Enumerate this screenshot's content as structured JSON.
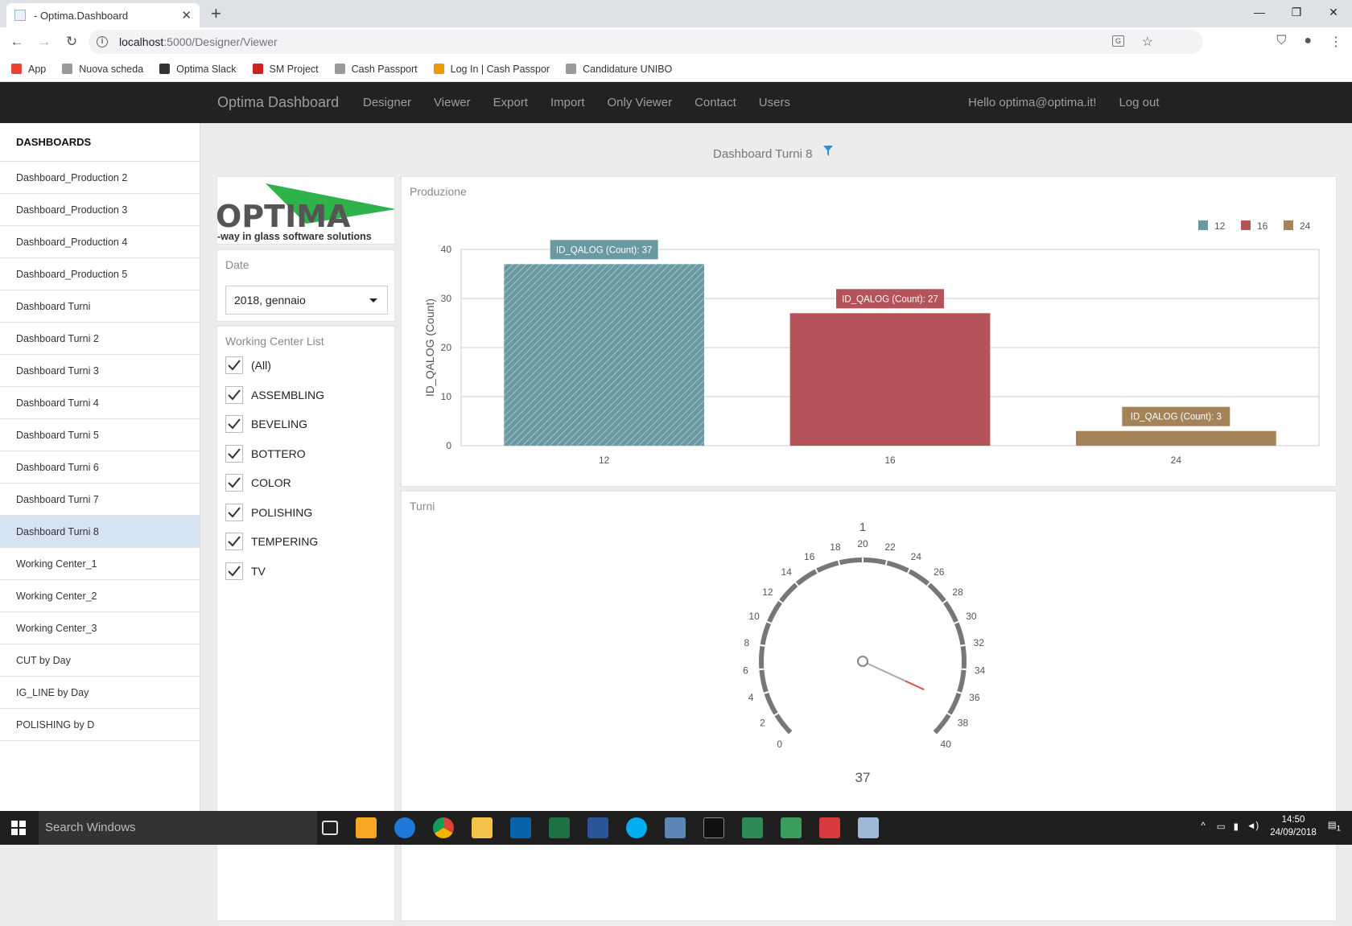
{
  "browser": {
    "tab_title": "- Optima.Dashboard",
    "url_host": "localhost",
    "url_rest": ":5000/Designer/Viewer",
    "bookmarks": [
      {
        "label": "App",
        "color": "#ea4335"
      },
      {
        "label": "Nuova scheda",
        "color": "#999999"
      },
      {
        "label": "Optima Slack",
        "color": "#333333"
      },
      {
        "label": "SM Project",
        "color": "#cc2222"
      },
      {
        "label": "Cash Passport",
        "color": "#999999"
      },
      {
        "label": "Log In | Cash Passpor",
        "color": "#f09800"
      },
      {
        "label": "Candidature UNIBO",
        "color": "#999999"
      }
    ]
  },
  "app": {
    "brand": "Optima Dashboard",
    "nav": [
      "Designer",
      "Viewer",
      "Export",
      "Import",
      "Only Viewer",
      "Contact",
      "Users"
    ],
    "greeting": "Hello optima@optima.it!",
    "logout": "Log out"
  },
  "sidebar": {
    "heading": "DASHBOARDS",
    "items": [
      "Dashboard_Production 2",
      "Dashboard_Production 3",
      "Dashboard_Production 4",
      "Dashboard_Production 5",
      "Dashboard Turni",
      "Dashboard Turni 2",
      "Dashboard Turni 3",
      "Dashboard Turni 4",
      "Dashboard Turni 5",
      "Dashboard Turni 6",
      "Dashboard Turni 7",
      "Dashboard Turni 8",
      "Working Center_1",
      "Working Center_2",
      "Working Center_3",
      "CUT by Day",
      "IG_LINE by Day",
      "POLISHING by D"
    ],
    "active_index": 11
  },
  "dashboard": {
    "title": "Dashboard Turni 8",
    "logo_text": "OPTIMA",
    "logo_tagline": "-way in glass software solutions",
    "date_label": "Date",
    "date_value": "2018, gennaio",
    "wc_label": "Working Center List",
    "wc_items": [
      "(All)",
      "ASSEMBLING",
      "BEVELING",
      "BOTTERO",
      "COLOR",
      "POLISHING",
      "TEMPERING",
      "TV"
    ]
  },
  "chart_data": [
    {
      "type": "bar",
      "title": "Produzione",
      "categories": [
        "12",
        "16",
        "24"
      ],
      "values": [
        37,
        27,
        3
      ],
      "colors": [
        "#6a9aa1",
        "#b5535a",
        "#a38357"
      ],
      "data_labels": [
        "ID_QALOG (Count): 37",
        "ID_QALOG (Count): 27",
        "ID_QALOG (Count): 3"
      ],
      "legend": [
        "12",
        "16",
        "24"
      ],
      "legend_position": "top-right",
      "ylabel": "ID_QALOG (Count)",
      "ylim": [
        0,
        40
      ],
      "yticks": [
        0,
        10,
        20,
        30,
        40
      ],
      "grid": true
    },
    {
      "type": "gauge",
      "title": "Turni",
      "top_label": "1",
      "min": 0,
      "max": 40,
      "ticks": [
        "0",
        "2",
        "4",
        "6",
        "8",
        "10",
        "12",
        "14",
        "16",
        "18",
        "20",
        "22",
        "24",
        "26",
        "28",
        "30",
        "32",
        "34",
        "36",
        "38",
        "40"
      ],
      "value": 37,
      "value_label": "37"
    }
  ],
  "taskbar": {
    "search": "Search Windows",
    "time": "14:50",
    "date": "24/09/2018",
    "notif_count": "1"
  }
}
